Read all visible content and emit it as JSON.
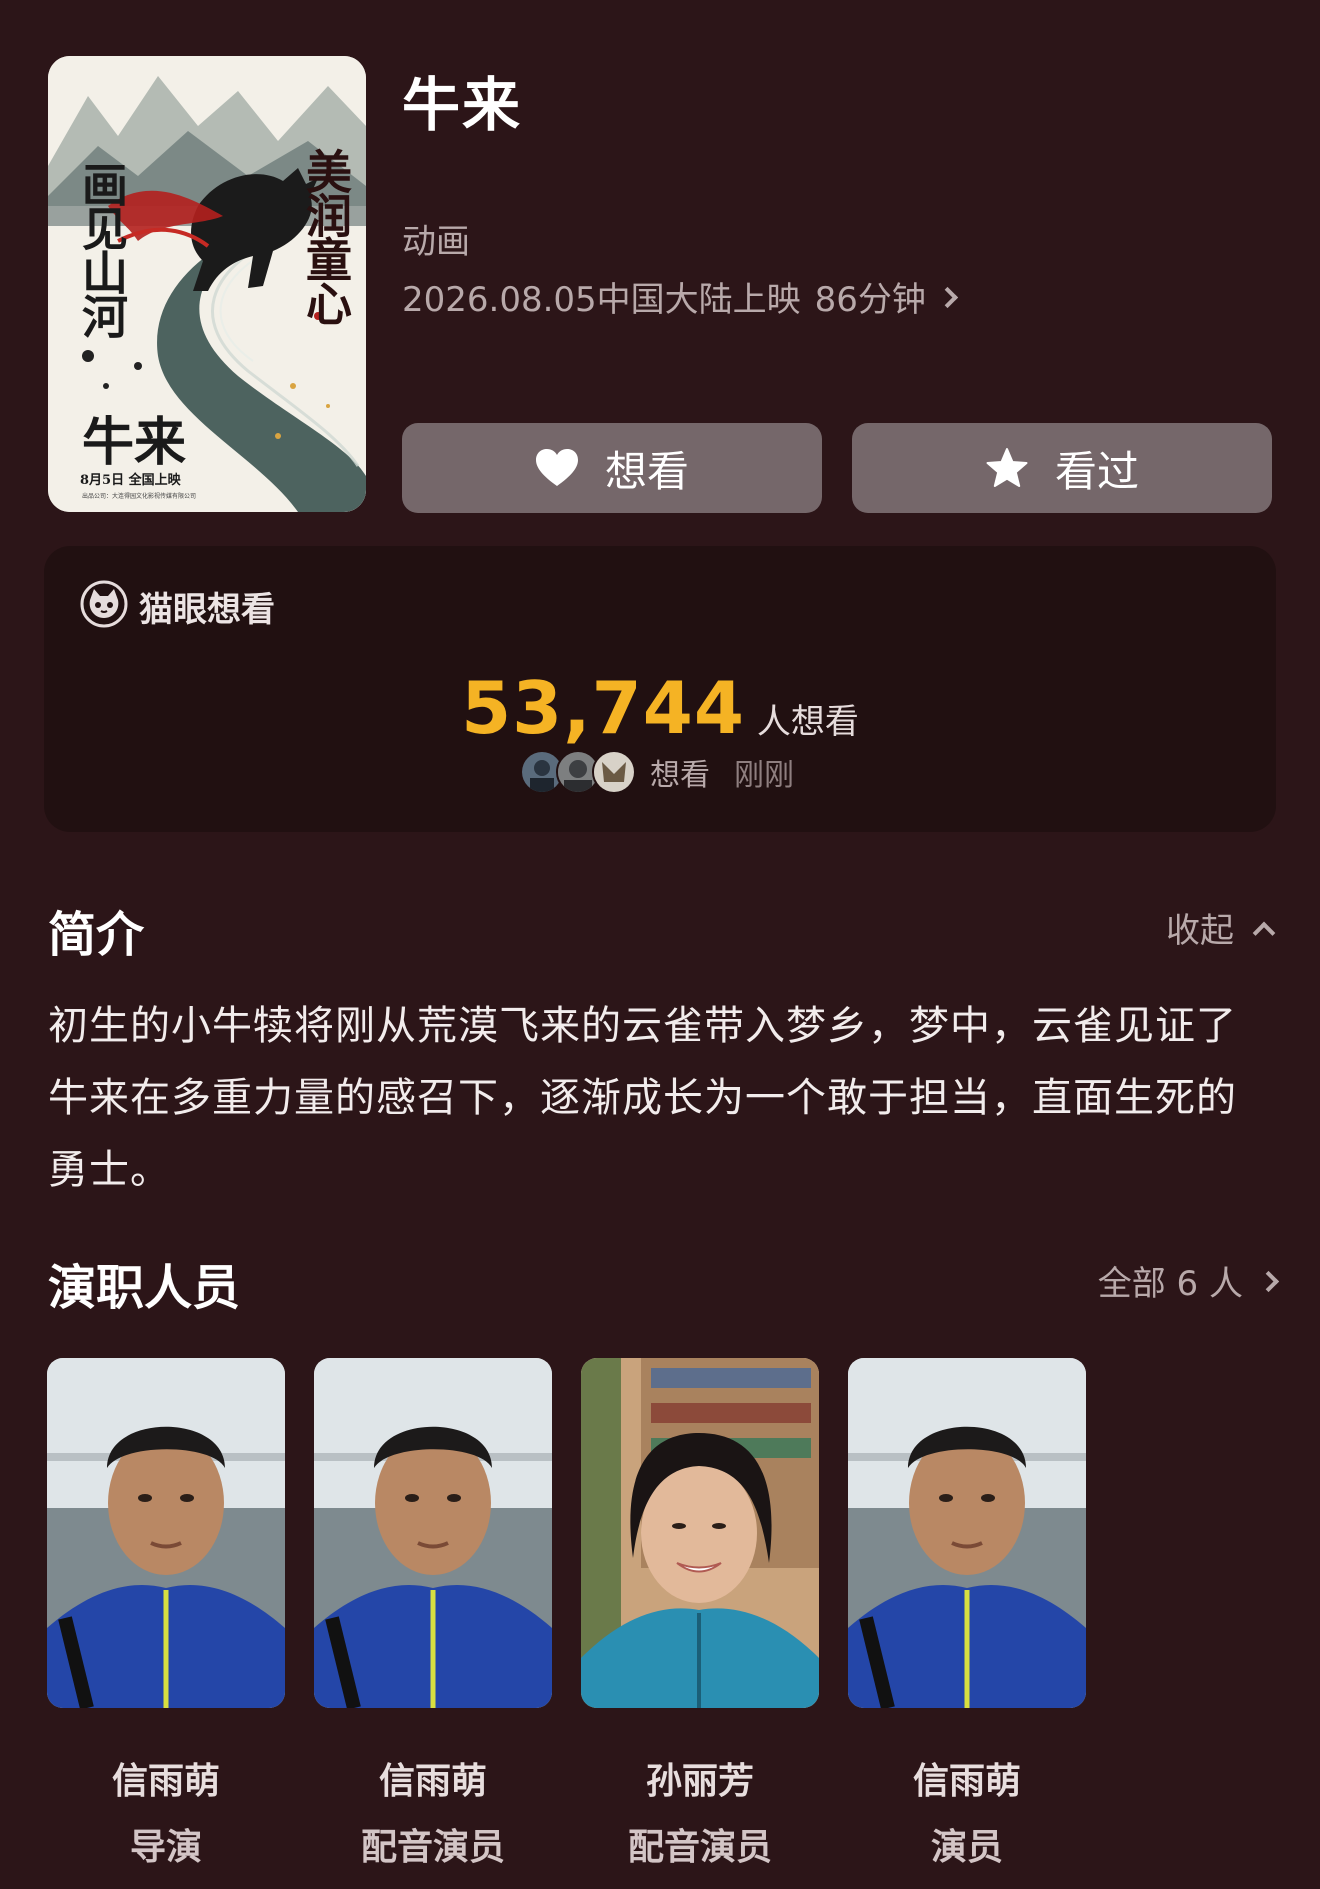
{
  "movie": {
    "title": "牛来",
    "genre": "动画",
    "release_date": "2026.08.05中国大陆上映",
    "duration": "86分钟",
    "poster": {
      "left_text": "画见山河",
      "right_text": "美润童心",
      "title_text": "牛来",
      "date_text": "8月5日  全国上映",
      "credit_text": "出品公司：大连得园文化影视传媒有限公司"
    }
  },
  "actions": {
    "want_label": "想看",
    "seen_label": "看过",
    "want_icon": "heart-icon",
    "seen_icon": "star-icon"
  },
  "want_card": {
    "label": "猫眼想看",
    "count": "53,744",
    "count_unit": "人想看",
    "recent_action": "想看",
    "recent_time": "刚刚",
    "accent_color": "#f5b324"
  },
  "intro": {
    "title": "简介",
    "collapse_label": "收起",
    "text": "初生的小牛犊将刚从荒漠飞来的云雀带入梦乡，梦中，云雀见证了牛来在多重力量的感召下，逐渐成长为一个敢于担当，直面生死的勇士。"
  },
  "cast": {
    "title": "演职人员",
    "all_label": "全部 6 人",
    "members": [
      {
        "name": "信雨萌",
        "role": "导演"
      },
      {
        "name": "信雨萌",
        "role": "配音演员"
      },
      {
        "name": "孙丽芳",
        "role": "配音演员"
      },
      {
        "name": "信雨萌",
        "role": "演员"
      }
    ]
  },
  "colors": {
    "background": "#2c1518",
    "card_background": "#211011",
    "button_background": "#75676a",
    "secondary_text": "#b8a9aa"
  }
}
